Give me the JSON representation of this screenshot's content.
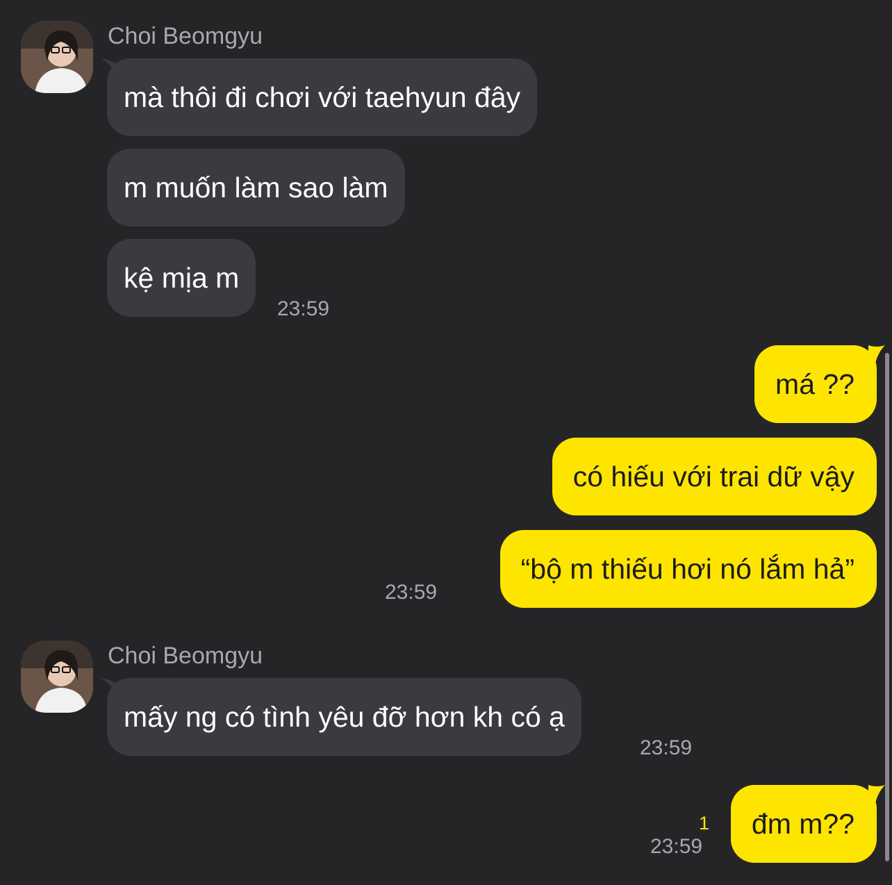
{
  "contact": {
    "name": "Choi Beomgyu"
  },
  "colors": {
    "background": "#252528",
    "incoming_bubble": "#3b3b3f",
    "outgoing_bubble": "#fee500",
    "meta_text": "#a9a9ad"
  },
  "groups": [
    {
      "sender": "Choi Beomgyu",
      "avatar_icon": "profile-photo",
      "messages": [
        "mà thôi đi chơi với taehyun đây",
        "m muốn làm sao làm",
        "kệ mịa m"
      ],
      "time": "23:59"
    },
    {
      "sender": "me",
      "messages": [
        "má ??",
        "có hiếu với trai dữ vậy",
        "“bộ m thiếu hơi nó lắm hả”"
      ],
      "time": "23:59"
    },
    {
      "sender": "Choi Beomgyu",
      "avatar_icon": "profile-photo",
      "messages": [
        "mấy ng có tình yêu đỡ hơn kh có ạ"
      ],
      "time": "23:59"
    },
    {
      "sender": "me",
      "messages": [
        "đm m??"
      ],
      "time": "23:59",
      "unread_count": "1"
    }
  ]
}
